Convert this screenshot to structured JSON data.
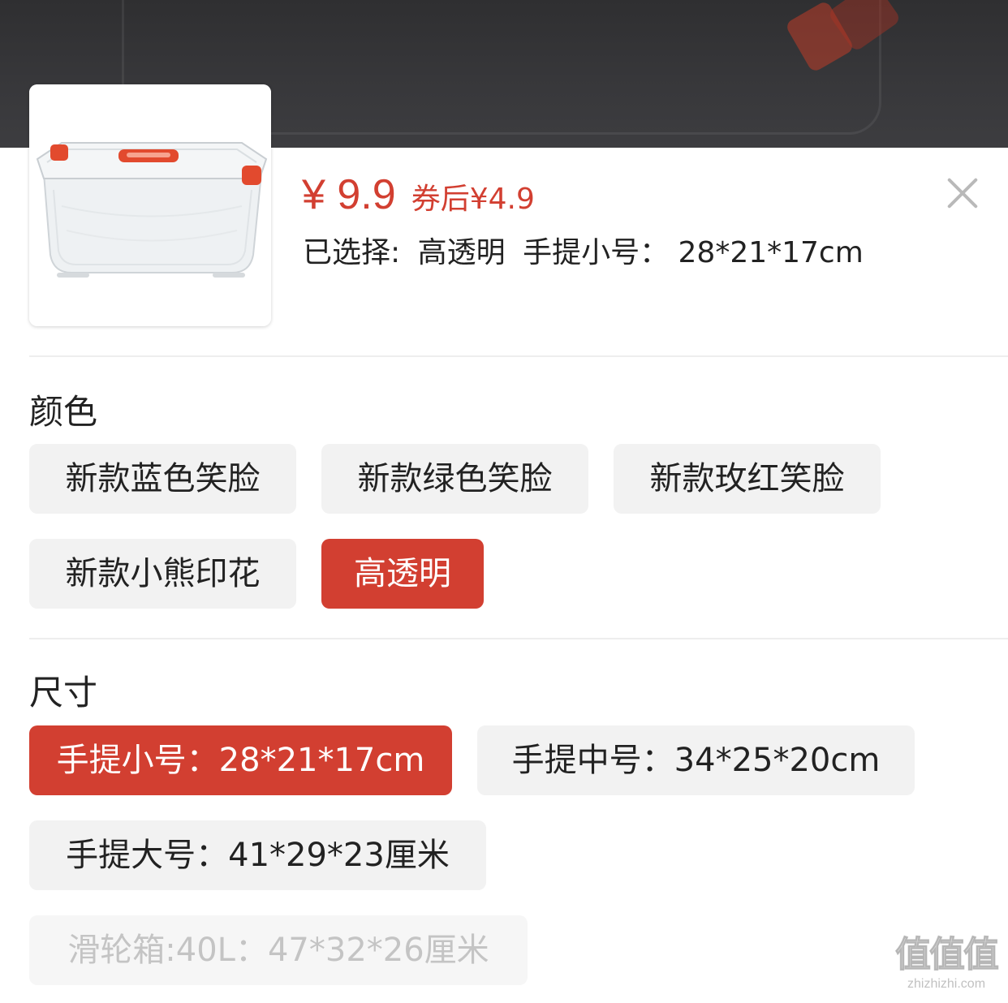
{
  "product": {
    "price": "¥ 9.9",
    "coupon_price": "券后¥4.9",
    "selected_prefix": "已选择:",
    "selected_color": "高透明",
    "selected_size": "手提小号： 28*21*17cm"
  },
  "color_section": {
    "title": "颜色",
    "options": [
      {
        "label": "新款蓝色笑脸",
        "state": "normal"
      },
      {
        "label": "新款绿色笑脸",
        "state": "normal"
      },
      {
        "label": "新款玫红笑脸",
        "state": "normal"
      },
      {
        "label": "新款小熊印花",
        "state": "normal"
      },
      {
        "label": "高透明",
        "state": "selected"
      }
    ]
  },
  "size_section": {
    "title": "尺寸",
    "options": [
      {
        "label": "手提小号：28*21*17cm",
        "state": "selected"
      },
      {
        "label": "手提中号：34*25*20cm",
        "state": "normal"
      },
      {
        "label": "手提大号：41*29*23厘米",
        "state": "normal"
      },
      {
        "label": "滑轮箱:40L：47*32*26厘米",
        "state": "disabled"
      }
    ]
  },
  "watermark": {
    "logo": "值值值",
    "domain": "zhizhizhi.com"
  },
  "colors": {
    "accent": "#d23f31",
    "chip_bg": "#f2f2f2",
    "disabled_text": "#c4c4c4"
  }
}
